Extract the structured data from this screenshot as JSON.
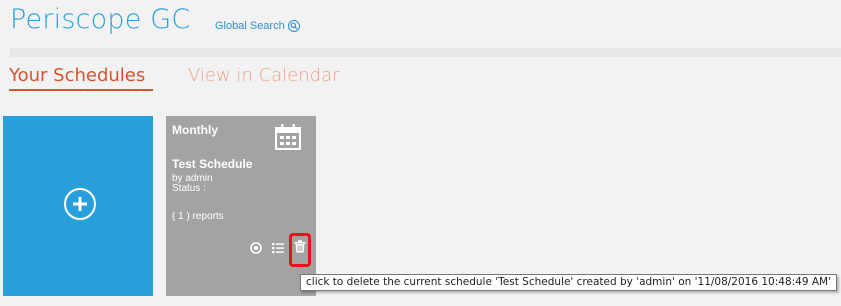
{
  "header": {
    "app_title": "Periscope GC",
    "global_search_label": "Global Search"
  },
  "tabs": [
    {
      "label": "Your Schedules",
      "active": true
    },
    {
      "label": "View in Calendar",
      "active": false
    }
  ],
  "add_tile": {
    "icon": "add-circle-icon"
  },
  "schedule_card": {
    "frequency": "Monthly",
    "name": "Test Schedule",
    "created_by": "by admin",
    "status": "Status :",
    "reports": "( 1 ) reports",
    "actions": [
      "run-icon",
      "details-icon",
      "delete-icon"
    ]
  },
  "tooltip": {
    "text": "click to delete the current schedule 'Test Schedule' created by 'admin' on '11/08/2016 10:48:49 AM'"
  },
  "colors": {
    "brand_blue": "#289fdb",
    "active_tab": "#d5542f",
    "inactive_tab": "#f0a08a",
    "card_gray": "#a3a3a3",
    "highlight_red": "#e8121d"
  }
}
